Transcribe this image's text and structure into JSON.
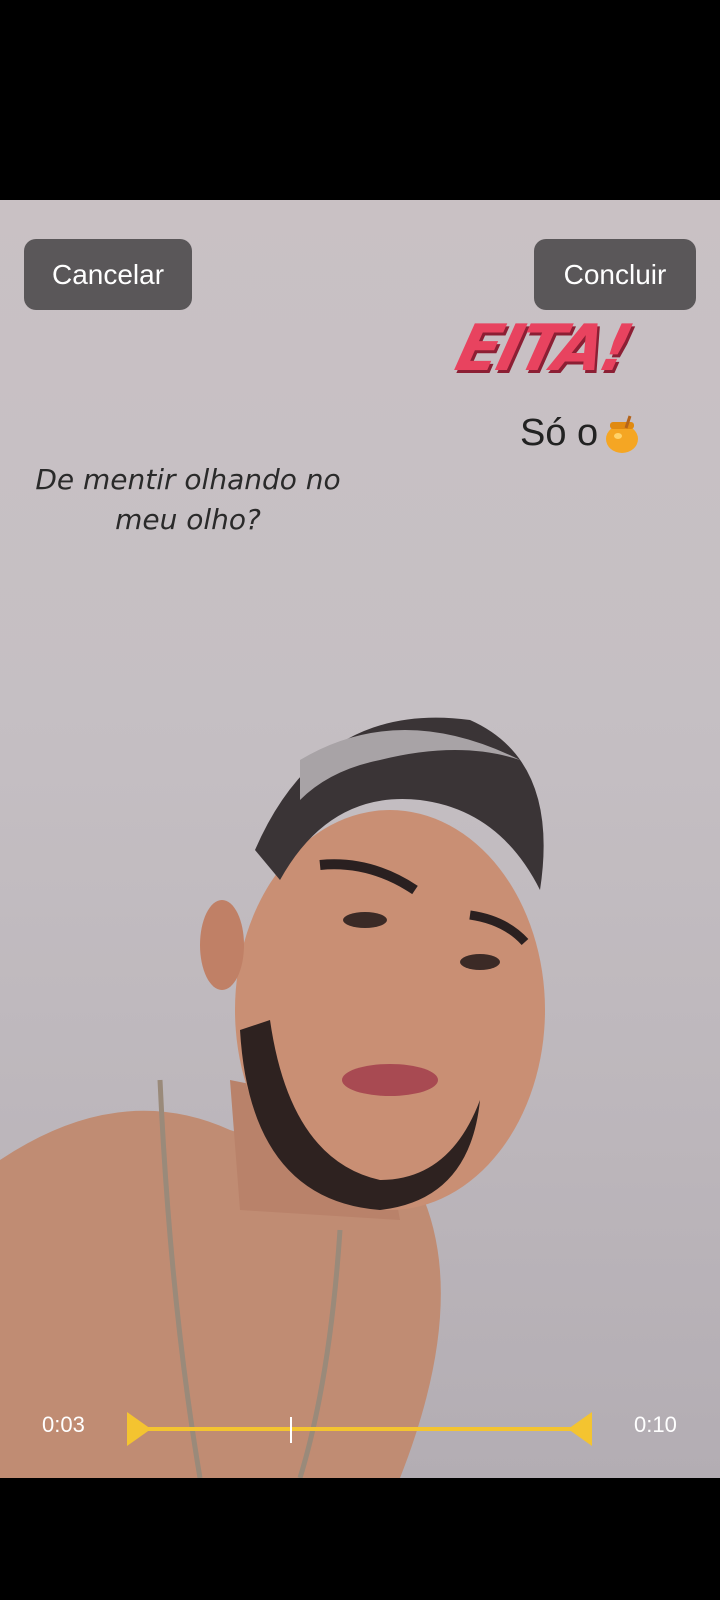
{
  "header": {
    "cancel_label": "Cancelar",
    "done_label": "Concluir"
  },
  "stickers": {
    "eita_text": "EITA!",
    "so_text": "Só o",
    "so_icon": "honey-pot-icon"
  },
  "caption": {
    "text": "De mentir olhando no meu olho?"
  },
  "trimmer": {
    "start_time": "0:03",
    "end_time": "0:10",
    "playhead_fraction": 0.34,
    "accent_color": "#f4c430"
  }
}
